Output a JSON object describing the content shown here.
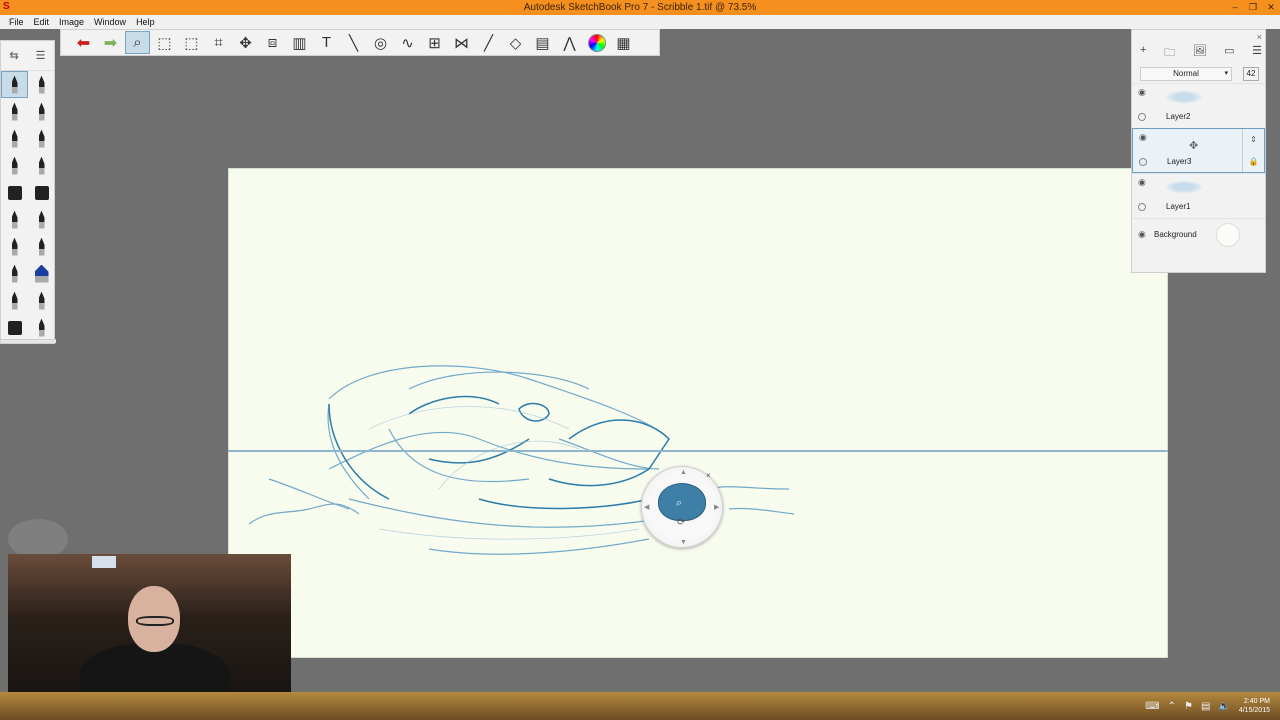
{
  "window": {
    "title": "Autodesk SketchBook Pro 7 - Scribble 1.tif @ 73.5%",
    "app_icon": "sketchbook-s-icon",
    "minimize": "–",
    "maximize": "❐",
    "close": "✕"
  },
  "menu": {
    "items": [
      "File",
      "Edit",
      "Image",
      "Window",
      "Help"
    ]
  },
  "toolbar": {
    "tools": [
      {
        "name": "undo-icon",
        "glyph": "⬅"
      },
      {
        "name": "redo-icon",
        "glyph": "➡"
      },
      {
        "name": "zoom-icon",
        "glyph": "🔍",
        "active": true
      },
      {
        "name": "select-icon",
        "glyph": "⬚"
      },
      {
        "name": "lasso-select-icon",
        "glyph": "⬚"
      },
      {
        "name": "crop-icon",
        "glyph": "⌗"
      },
      {
        "name": "transform-icon",
        "glyph": "✥"
      },
      {
        "name": "distort-icon",
        "glyph": "⧈"
      },
      {
        "name": "fill-icon",
        "glyph": "🪣"
      },
      {
        "name": "text-icon",
        "glyph": "T"
      },
      {
        "name": "ruler-icon",
        "glyph": "📏"
      },
      {
        "name": "ellipse-guide-icon",
        "glyph": "◎"
      },
      {
        "name": "french-curve-icon",
        "glyph": "∿"
      },
      {
        "name": "perspective-icon",
        "glyph": "⊞"
      },
      {
        "name": "symmetry-icon",
        "glyph": "⋈"
      },
      {
        "name": "line-icon",
        "glyph": "╱"
      },
      {
        "name": "shape-icon",
        "glyph": "◇"
      },
      {
        "name": "copic-library-icon",
        "glyph": "▤"
      },
      {
        "name": "brush-library-icon",
        "glyph": "⋀"
      },
      {
        "name": "color-wheel-icon",
        "glyph": ""
      },
      {
        "name": "layer-grid-icon",
        "glyph": "▦"
      }
    ]
  },
  "brush_palette": {
    "header_left": "⇆",
    "header_right": "☰",
    "brushes": [
      "pencil-brush",
      "ballpoint-brush",
      "marker-brush",
      "felt-brush",
      "airbrush-brush",
      "inking-brush",
      "pen-brush",
      "chisel-brush",
      "block-eraser-brush",
      "soft-eraser-brush",
      "paint-brush",
      "fine-brush",
      "water-brush",
      "smudge-brush",
      "pastel-brush",
      "blue-marker-brush",
      "stipple-brush",
      "stamp-brush",
      "round-brush",
      "flat-brush"
    ]
  },
  "layers": {
    "close": "×",
    "icons": [
      "+",
      "🗀",
      "🖼",
      "▭",
      "☰"
    ],
    "blend_mode": "Normal",
    "opacity": "42",
    "items": [
      {
        "name": "Layer2",
        "selected": false
      },
      {
        "name": "Layer3",
        "selected": true
      },
      {
        "name": "Layer1",
        "selected": false
      }
    ],
    "background_label": "Background"
  },
  "puck": {
    "zoom_glyph": "⌕",
    "rotate_glyph": "⟳",
    "close_glyph": "×"
  },
  "taskbar": {
    "time": "2:40 PM",
    "date": "4/15/2015"
  }
}
